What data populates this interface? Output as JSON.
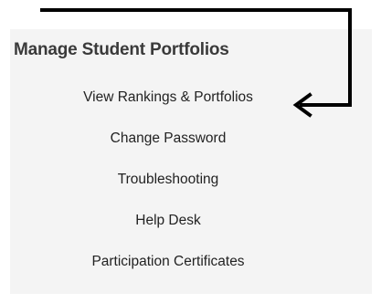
{
  "panel": {
    "title": "Manage Student Portfolios",
    "items": [
      {
        "label": "View Rankings & Portfolios"
      },
      {
        "label": "Change Password"
      },
      {
        "label": "Troubleshooting"
      },
      {
        "label": "Help Desk"
      },
      {
        "label": "Participation Certificates"
      }
    ]
  },
  "annotation": {
    "color": "#000000",
    "points_to": "View Rankings & Portfolios"
  }
}
